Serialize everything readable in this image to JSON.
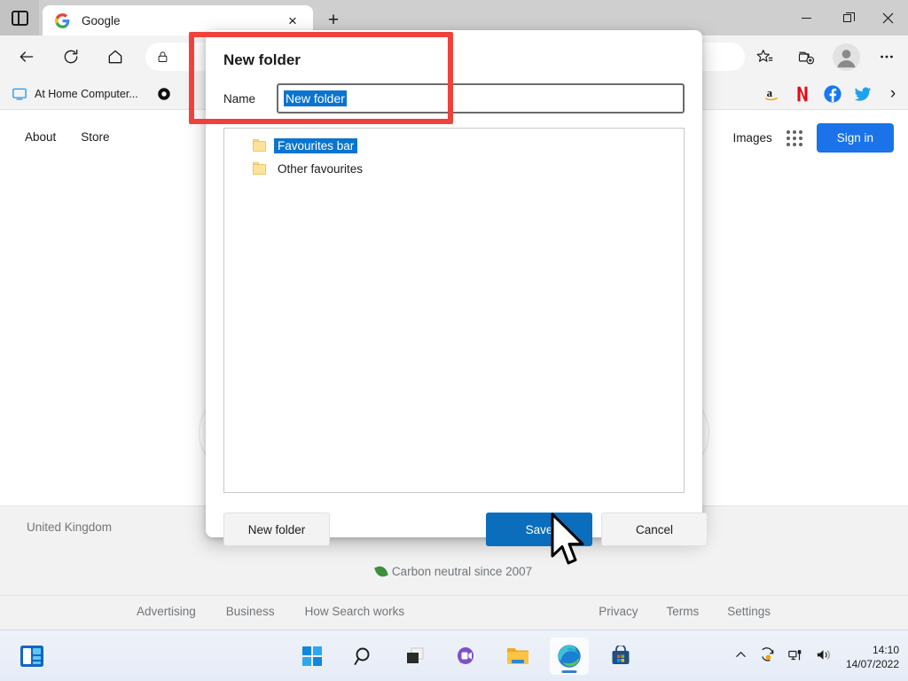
{
  "browser": {
    "tab": {
      "title": "Google",
      "favicon": "google-favicon",
      "close_label": "×"
    },
    "new_tab_label": "+",
    "window_controls": {
      "minimize": "–",
      "maximize": "❐",
      "close": "×"
    },
    "toolbar": {
      "back": "back-arrow-icon",
      "refresh": "refresh-icon",
      "home": "home-icon",
      "favorites": "favorites-star-icon",
      "collections": "collections-icon",
      "profile": "profile-avatar-icon",
      "settings": "ellipsis-icon"
    },
    "favourites_bar": {
      "items": [
        {
          "label": "At Home Computer...",
          "icon": "monitor-icon"
        },
        {
          "label": "",
          "icon": "dark-circle-icon"
        }
      ],
      "shortcuts": [
        "amazon-icon",
        "netflix-icon",
        "facebook-icon",
        "twitter-icon"
      ],
      "overflow": "›"
    }
  },
  "page": {
    "top_links": [
      "About",
      "Store"
    ],
    "images_link": "Images",
    "apps_icon": "google-apps-grid-icon",
    "sign_in": "Sign in",
    "country": "United Kingdom",
    "carbon": "Carbon neutral since 2007",
    "footer_left": [
      "Advertising",
      "Business",
      "How Search works"
    ],
    "footer_right": [
      "Privacy",
      "Terms",
      "Settings"
    ]
  },
  "dialog": {
    "title": "New folder",
    "name_label": "Name",
    "name_value": "New folder",
    "tree": [
      {
        "label": "Favourites bar",
        "selected": true
      },
      {
        "label": "Other favourites",
        "selected": false
      }
    ],
    "buttons": {
      "new_folder": "New folder",
      "save": "Save",
      "cancel": "Cancel"
    },
    "accent_color": "#0a6ebd",
    "selection_color": "#0a74d0"
  },
  "annotation": {
    "color": "#f0423c"
  },
  "taskbar": {
    "widgets": "widgets-icon",
    "apps": [
      {
        "name": "start-icon",
        "active": false
      },
      {
        "name": "search-icon",
        "active": false
      },
      {
        "name": "task-view-icon",
        "active": false
      },
      {
        "name": "chat-icon",
        "active": false
      },
      {
        "name": "file-explorer-icon",
        "active": false
      },
      {
        "name": "microsoft-edge-icon",
        "active": true
      },
      {
        "name": "microsoft-store-icon",
        "active": false
      }
    ],
    "tray": [
      "chevron-up-icon",
      "onedrive-sync-icon",
      "network-icon",
      "volume-icon"
    ],
    "time": "14:10",
    "date": "14/07/2022"
  }
}
